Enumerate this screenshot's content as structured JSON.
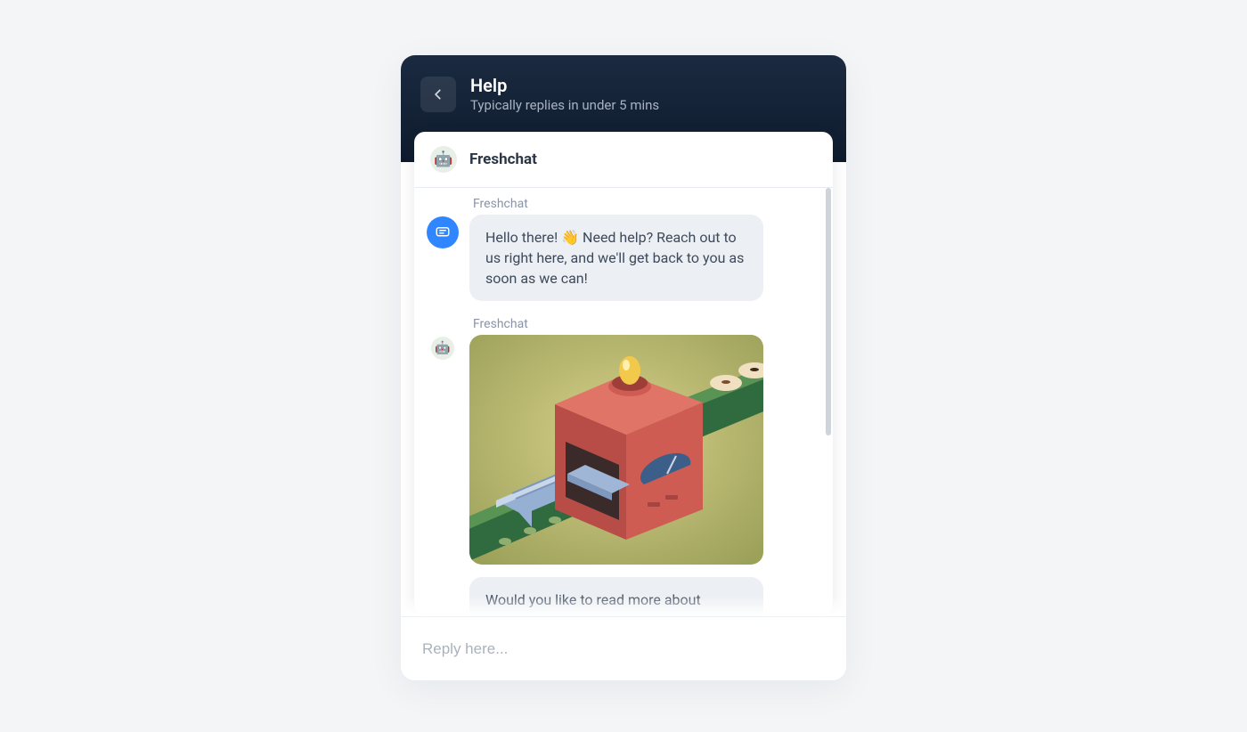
{
  "header": {
    "title": "Help",
    "subtitle": "Typically replies in under 5 mins"
  },
  "agent": {
    "name": "Freshchat",
    "avatar_emoji": "🤖"
  },
  "messages": [
    {
      "sender": "Freshchat",
      "side_icon": "chat-bubble-icon",
      "text": "Hello there! 👋 Need help? Reach out to us right here, and we'll get back to you as soon as we can!"
    },
    {
      "sender": "Freshchat",
      "side_icon": "bot-avatar-icon",
      "has_image": true,
      "image_alt": "conveyor-belt-illustration"
    },
    {
      "text": "Would you like to read more about"
    }
  ],
  "input": {
    "placeholder": "Reply here..."
  }
}
